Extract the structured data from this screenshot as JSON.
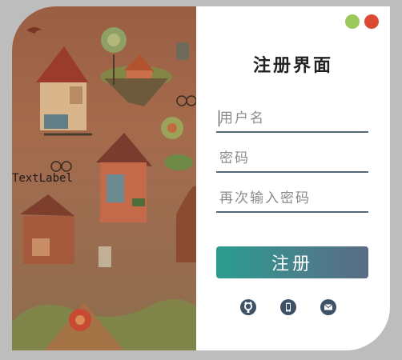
{
  "art": {
    "label": "TextLabel"
  },
  "panel": {
    "title": "注册界面",
    "fields": [
      {
        "placeholder": "用户名",
        "value": ""
      },
      {
        "placeholder": "密码",
        "value": ""
      },
      {
        "placeholder": "再次输入密码",
        "value": ""
      }
    ],
    "submit_label": "注册"
  },
  "icons": [
    "github-icon",
    "phone-icon",
    "mail-icon"
  ],
  "colors": {
    "background": "#bdbdbd",
    "minimize": "#9cc95b",
    "close": "#dc4a32",
    "underline": "#566a78",
    "button_start": "#2a9d8f",
    "button_end": "#5a6b86",
    "icon": "#3e5166"
  }
}
